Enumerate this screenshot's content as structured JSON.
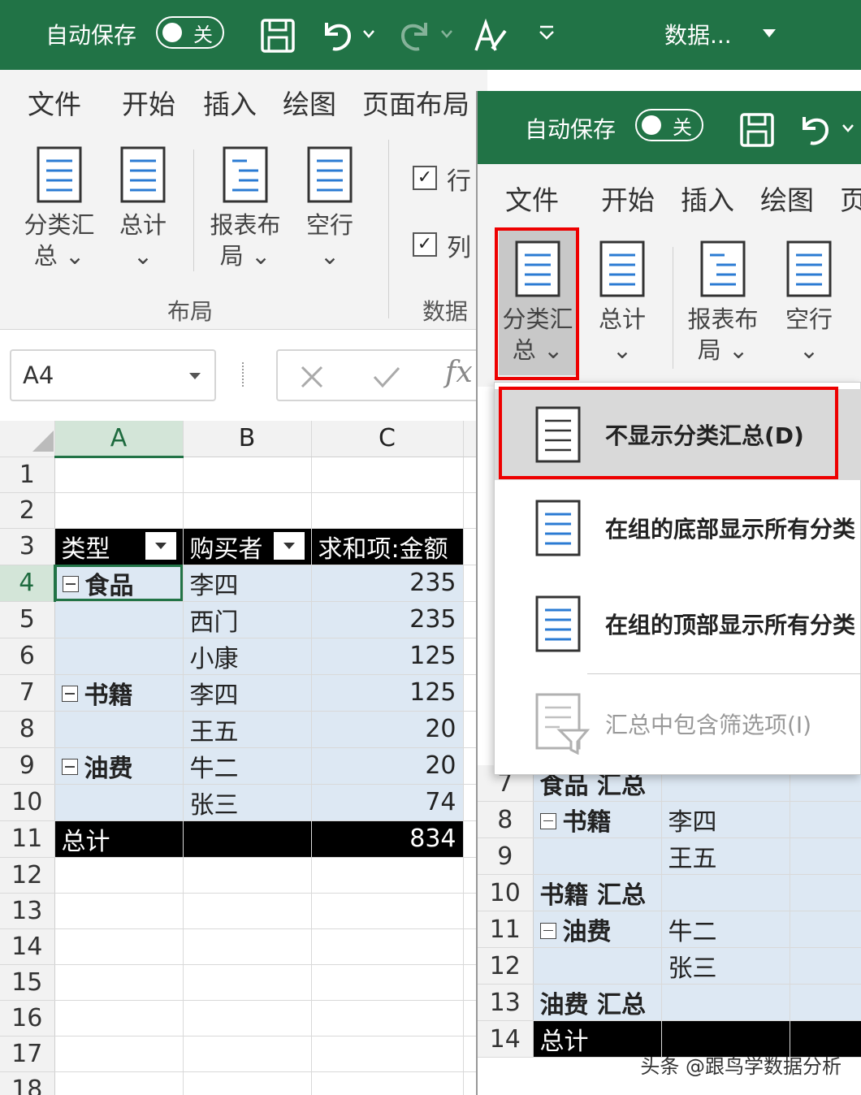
{
  "titlebar": {
    "autosave_label": "自动保存",
    "toggle_state": "关",
    "doc_title": "数据..."
  },
  "menu": [
    "文件",
    "开始",
    "插入",
    "绘图",
    "页面布局"
  ],
  "menu_right": [
    "文件",
    "开始",
    "插入",
    "绘图",
    "页"
  ],
  "ribbon": {
    "btn_subtotal": "分类汇总",
    "btn_subtotal_line1": "分类汇",
    "btn_subtotal_line2": "总",
    "btn_grandtotal": "总计",
    "btn_report_line1": "报表布",
    "btn_report_line2": "局",
    "btn_blankrow": "空行",
    "group_layout": "布局",
    "check_rows": "行",
    "check_cols": "列",
    "group_data": "数据"
  },
  "formula_bar": {
    "name_box": "A4"
  },
  "sheet": {
    "columns": [
      "A",
      "B",
      "C"
    ],
    "rows": [
      "1",
      "2",
      "3",
      "4",
      "5",
      "6",
      "7",
      "8",
      "9",
      "10",
      "11",
      "12",
      "13",
      "14",
      "15",
      "16",
      "17",
      "18"
    ],
    "header": {
      "type": "类型",
      "buyer": "购买者",
      "sum": "求和项:金额"
    },
    "data": [
      {
        "cat": "食品",
        "buyer": "李四",
        "amount": "235"
      },
      {
        "cat": "",
        "buyer": "西门",
        "amount": "235"
      },
      {
        "cat": "",
        "buyer": "小康",
        "amount": "125"
      },
      {
        "cat": "书籍",
        "buyer": "李四",
        "amount": "125"
      },
      {
        "cat": "",
        "buyer": "王五",
        "amount": "20"
      },
      {
        "cat": "油费",
        "buyer": "牛二",
        "amount": "20"
      },
      {
        "cat": "",
        "buyer": "张三",
        "amount": "74"
      }
    ],
    "total_label": "总计",
    "total_value": "834"
  },
  "dropdown": {
    "item1": "不显示分类汇总(D)",
    "item2": "在组的底部显示所有分类",
    "item3": "在组的顶部显示所有分类",
    "item4": "汇总中包含筛选项(I)"
  },
  "sheet2": {
    "rows": [
      {
        "n": "7",
        "a": "食品 汇总",
        "b": ""
      },
      {
        "n": "8",
        "a": "书籍",
        "b": "李四"
      },
      {
        "n": "9",
        "a": "",
        "b": "王五"
      },
      {
        "n": "10",
        "a": "书籍 汇总",
        "b": ""
      },
      {
        "n": "11",
        "a": "油费",
        "b": "牛二"
      },
      {
        "n": "12",
        "a": "",
        "b": "张三"
      },
      {
        "n": "13",
        "a": "油费 汇总",
        "b": ""
      },
      {
        "n": "14",
        "a": "总计",
        "b": ""
      }
    ]
  },
  "watermark": "头条 @跟鸟学数据分析",
  "colors": {
    "excel_green": "#217346",
    "highlight_red": "#e00000",
    "pivot_blue": "#dde8f3"
  }
}
